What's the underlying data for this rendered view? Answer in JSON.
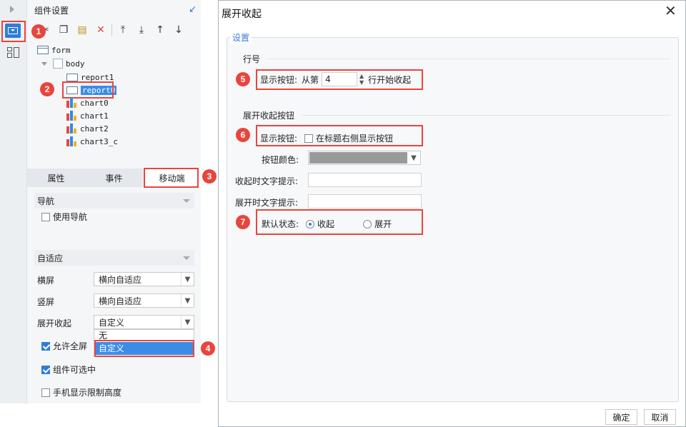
{
  "left_panel": {
    "title": "组件设置",
    "tree": {
      "form": "form",
      "body": "body",
      "report1": "report1",
      "report0": "report0",
      "charts": [
        "chart0",
        "chart1",
        "chart2",
        "chart3_c"
      ]
    },
    "tabs": [
      "属性",
      "事件",
      "移动端"
    ],
    "nav_section": "导航",
    "use_nav_label": "使用导航",
    "adaptive_section": "自适应",
    "landscape_label": "横屏",
    "landscape_value": "横向自适应",
    "portrait_label": "竖屏",
    "portrait_value": "横向自适应",
    "expand_label": "展开收起",
    "expand_value": "自定义",
    "dropdown_options": [
      "无",
      "自定义"
    ],
    "allow_fullscreen_label": "允许全屏",
    "selectable_label": "组件可选中",
    "limit_height_label": "手机显示限制高度"
  },
  "badges": [
    "1",
    "2",
    "3",
    "4",
    "5",
    "6",
    "7"
  ],
  "dialog": {
    "title": "展开收起",
    "settings_group": "设置",
    "row_section": "行号",
    "show_button_label": "显示按钮:",
    "from_label": "从第",
    "row_value": "4",
    "row_suffix": "行开始收起",
    "button_section": "展开收起按钮",
    "show_button_label2": "显示按钮:",
    "show_right_label": "在标题右侧显示按钮",
    "button_color_label": "按钮颜色:",
    "button_color": "#9a9a9a",
    "collapse_hint_label": "收起时文字提示:",
    "expand_hint_label": "展开时文字提示:",
    "default_state_label": "默认状态:",
    "state_collapse": "收起",
    "state_expand": "展开",
    "ok_button": "确定",
    "cancel_button": "取消"
  },
  "colors": {
    "accent": "#2d7ed8",
    "highlight": "#e8453c",
    "selected": "#3c8ce7"
  }
}
